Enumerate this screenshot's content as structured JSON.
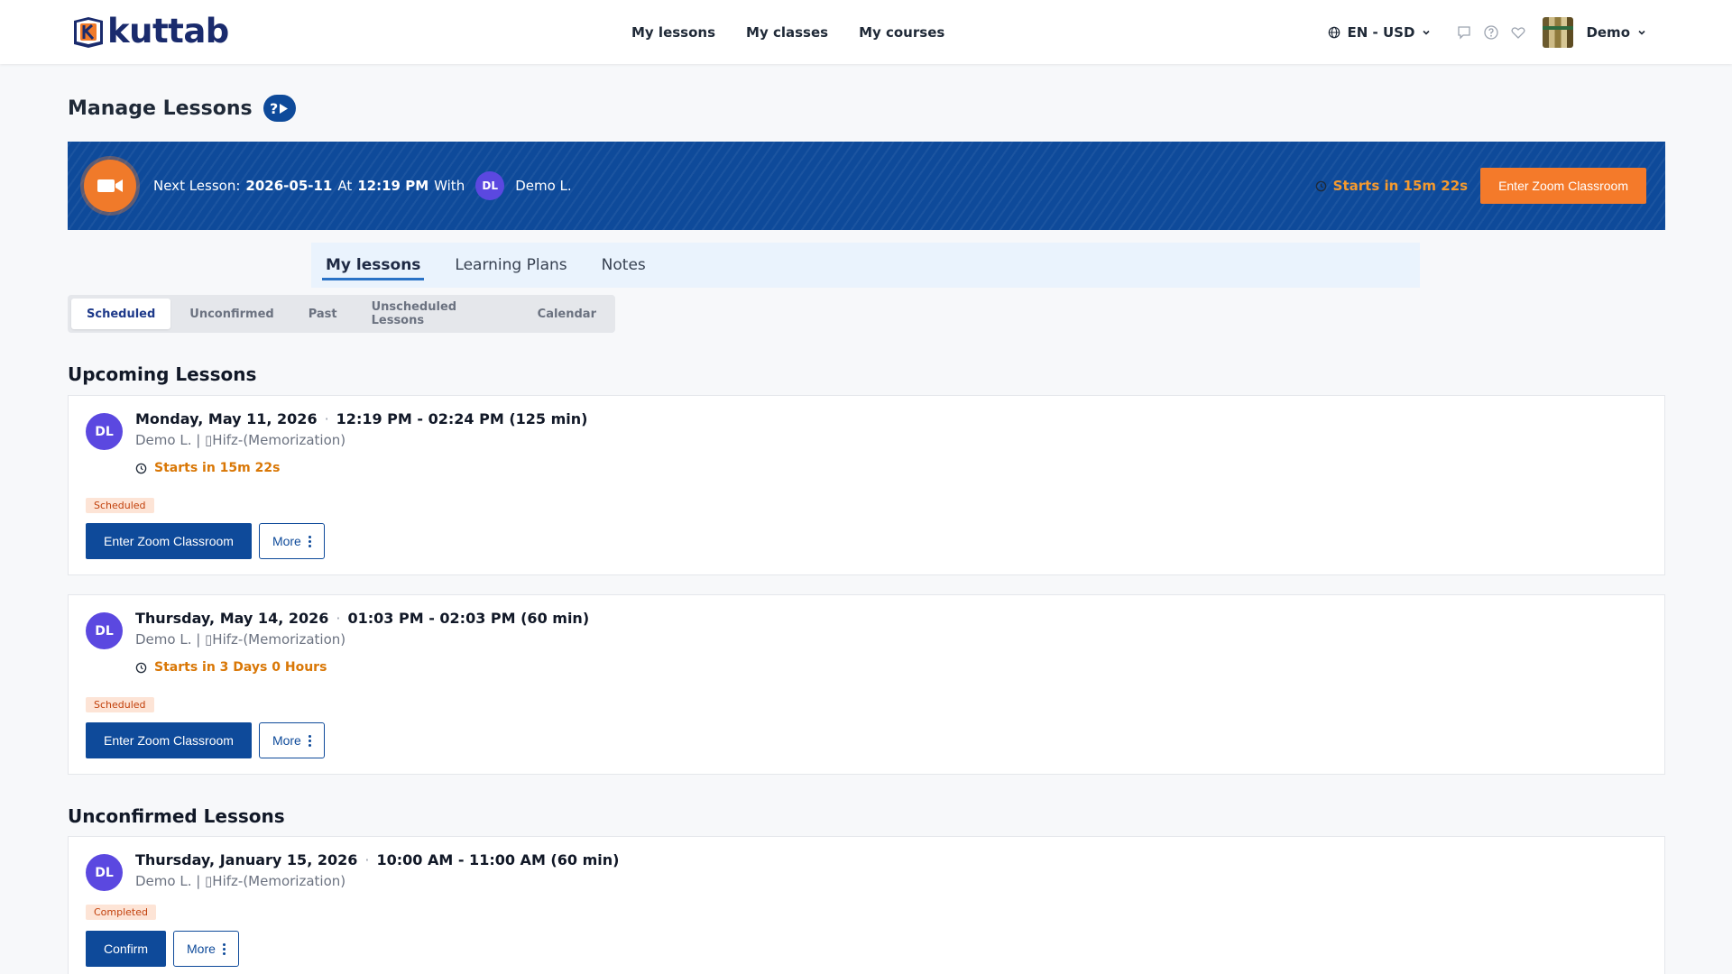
{
  "header": {
    "logo_text": "kuttab",
    "nav": [
      "My lessons",
      "My classes",
      "My courses"
    ],
    "lang": "EN - USD",
    "user": "Demo"
  },
  "page": {
    "title": "Manage Lessons"
  },
  "banner": {
    "prefix": "Next Lesson:",
    "date": "2026-05-11",
    "at": "At",
    "time": "12:19 PM",
    "with": "With",
    "teacher_initials": "DL",
    "teacher": "Demo L.",
    "starts": "Starts in 15m 22s",
    "button": "Enter Zoom Classroom"
  },
  "tabs": [
    "My lessons",
    "Learning Plans",
    "Notes"
  ],
  "segments": [
    "Scheduled",
    "Unconfirmed",
    "Past",
    "Unscheduled Lessons",
    "Calendar"
  ],
  "upcoming": {
    "title": "Upcoming Lessons",
    "lessons": [
      {
        "initials": "DL",
        "date": "Monday, May 11, 2026",
        "time": "12:19 PM - 02:24 PM (125 min)",
        "sub": "Demo L. | ▯Hifz-(Memorization)",
        "starts": "Starts in 15m 22s",
        "status": "Scheduled",
        "primary": "Enter Zoom Classroom",
        "more": "More"
      },
      {
        "initials": "DL",
        "date": "Thursday, May 14, 2026",
        "time": "01:03 PM - 02:03 PM (60 min)",
        "sub": "Demo L. | ▯Hifz-(Memorization)",
        "starts": "Starts in 3 Days 0 Hours",
        "status": "Scheduled",
        "primary": "Enter Zoom Classroom",
        "more": "More"
      }
    ]
  },
  "unconfirmed": {
    "title": "Unconfirmed Lessons",
    "lessons": [
      {
        "initials": "DL",
        "date": "Thursday, January 15, 2026",
        "time": "10:00 AM - 11:00 AM (60 min)",
        "sub": "Demo L. | ▯Hifz-(Memorization)",
        "status": "Completed",
        "primary": "Confirm",
        "more": "More"
      }
    ]
  },
  "colors": {
    "brand_blue": "#0e4a9a",
    "accent_orange": "#f47a2a",
    "avatar_purple": "#5b48e0"
  }
}
